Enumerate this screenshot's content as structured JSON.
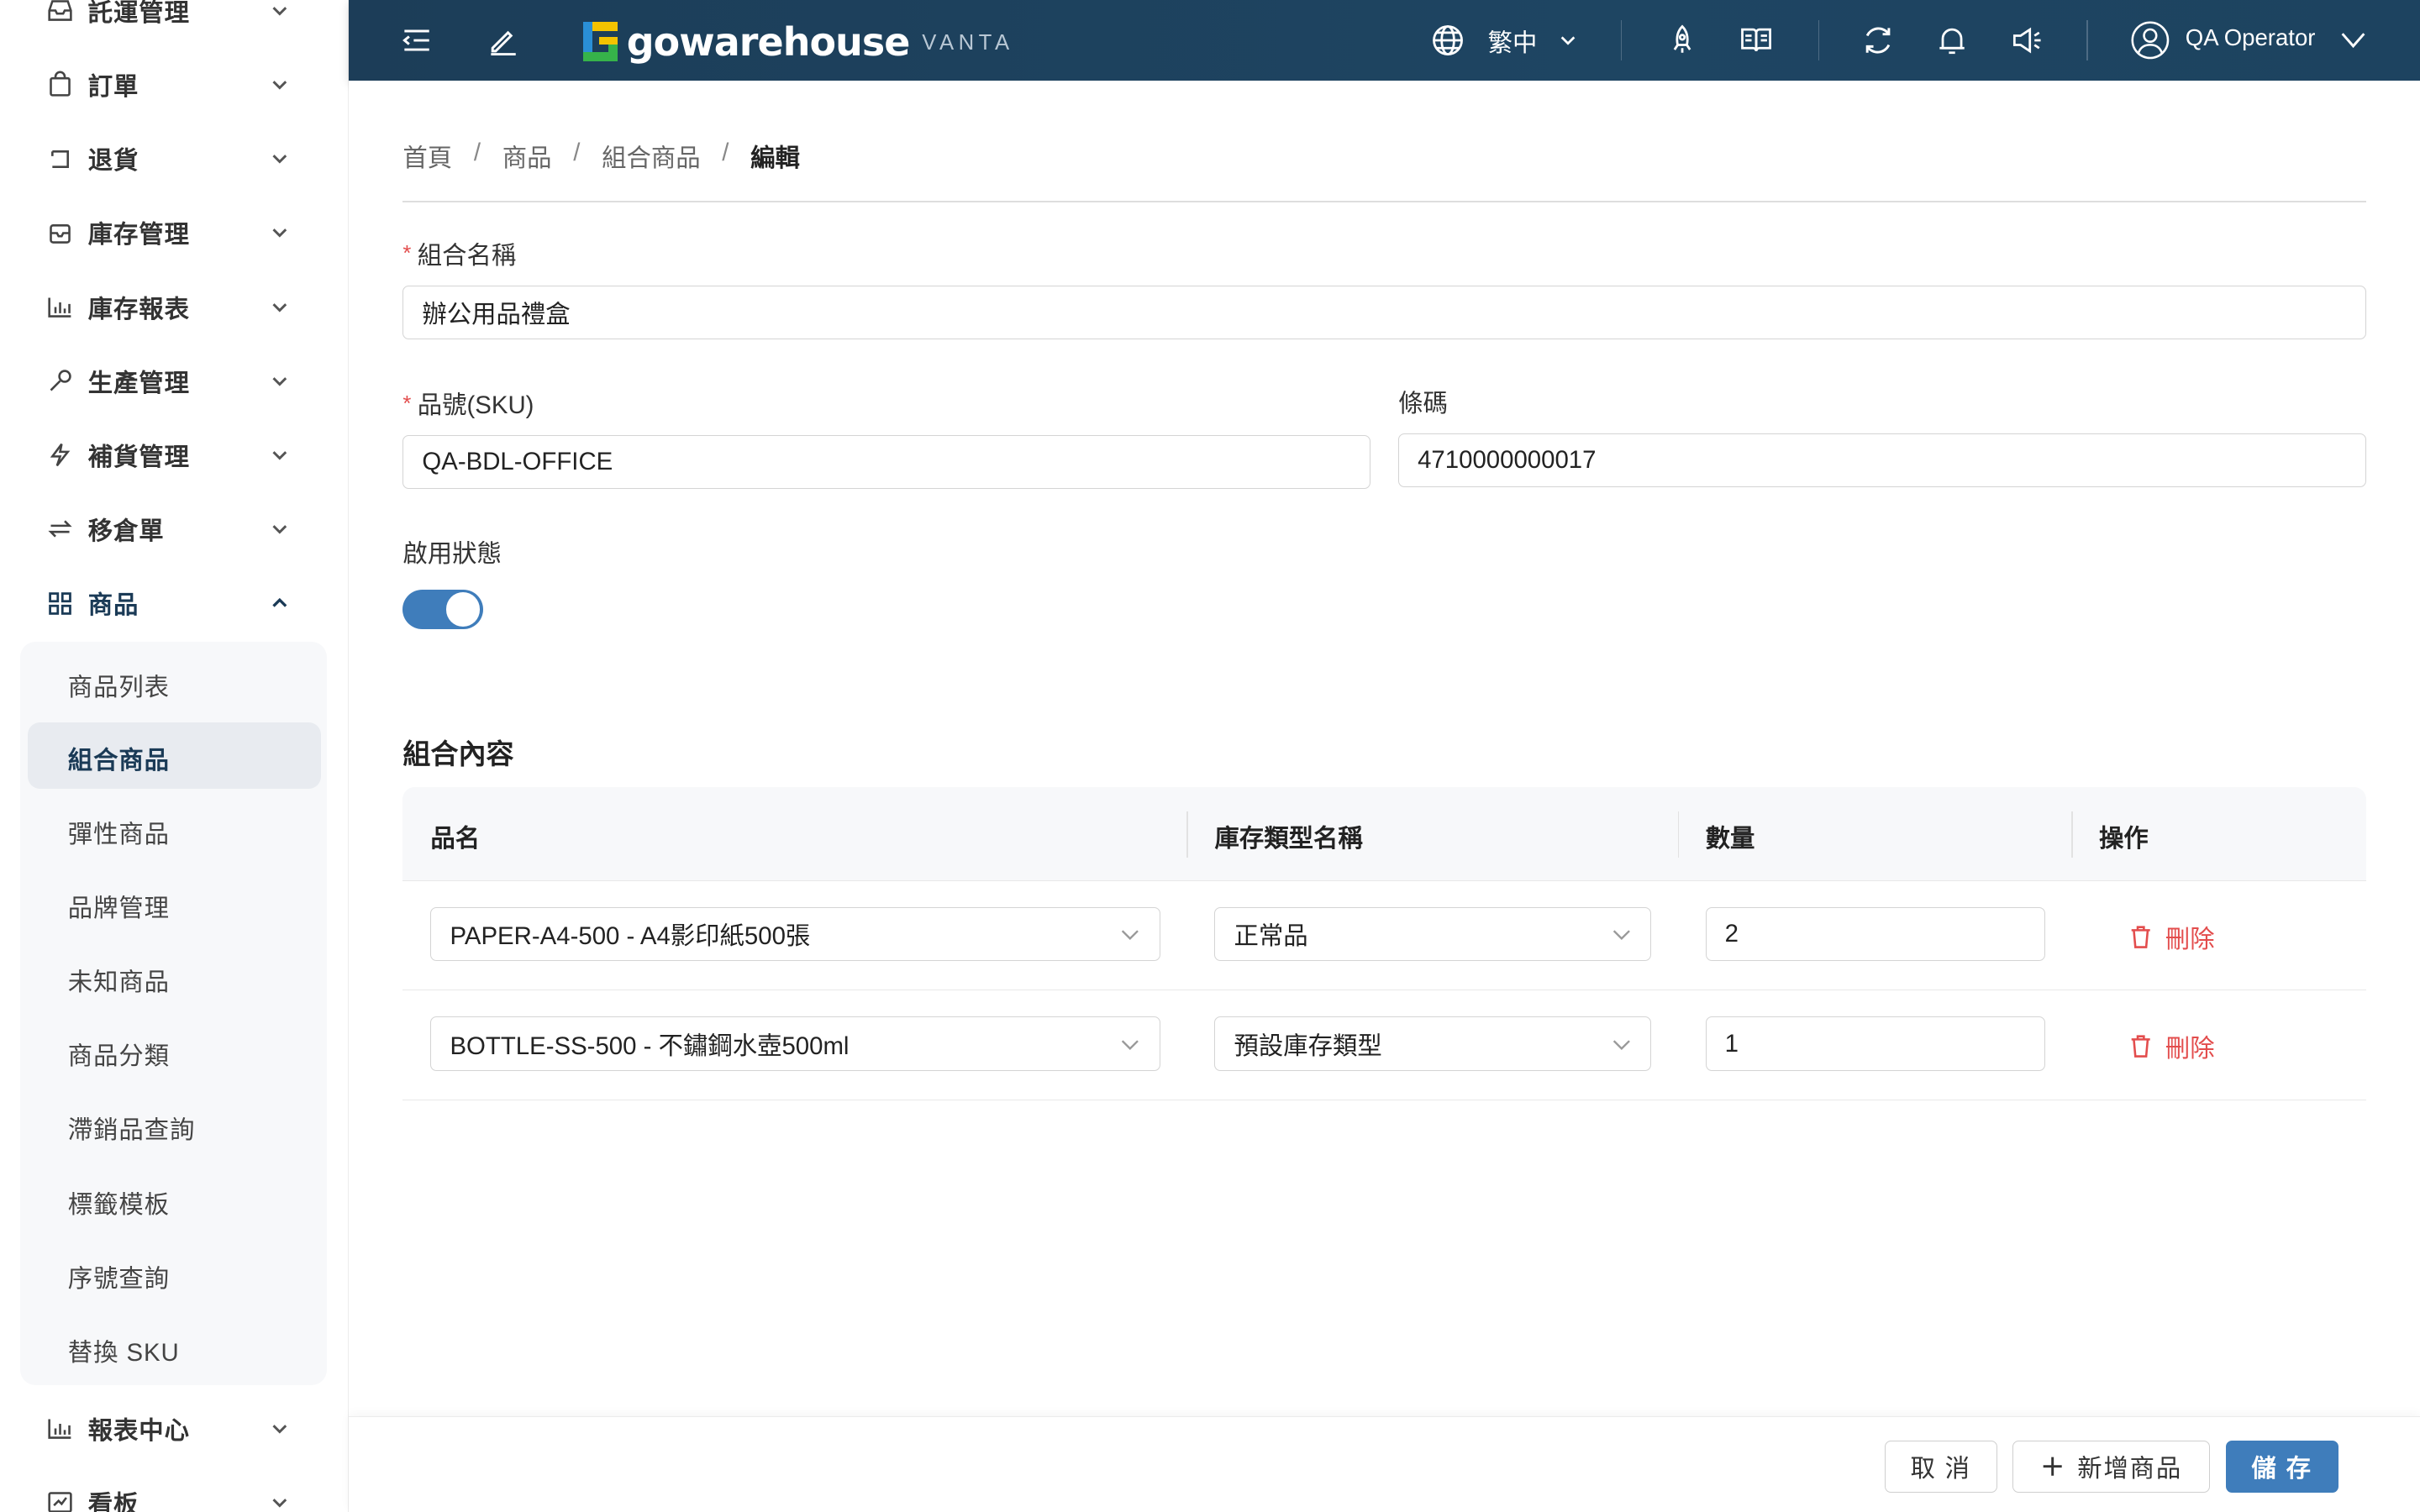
{
  "sidebar": {
    "items": [
      {
        "label": "託運管理"
      },
      {
        "label": "訂單"
      },
      {
        "label": "退貨"
      },
      {
        "label": "庫存管理"
      },
      {
        "label": "庫存報表"
      },
      {
        "label": "生產管理"
      },
      {
        "label": "補貨管理"
      },
      {
        "label": "移倉單"
      },
      {
        "label": "商品"
      },
      {
        "label": "報表中心"
      },
      {
        "label": "看板"
      }
    ],
    "submenu": [
      {
        "label": "商品列表"
      },
      {
        "label": "組合商品"
      },
      {
        "label": "彈性商品"
      },
      {
        "label": "品牌管理"
      },
      {
        "label": "未知商品"
      },
      {
        "label": "商品分類"
      },
      {
        "label": "滯銷品查詢"
      },
      {
        "label": "標籤模板"
      },
      {
        "label": "序號查詢"
      },
      {
        "label": "替換 SKU"
      }
    ],
    "active_submenu": "組合商品"
  },
  "header": {
    "logo_text": "gowarehouse",
    "logo_sub": "VANTA",
    "language": "繁中",
    "user": "QA Operator",
    "colors": {
      "bar": "#1e4562",
      "logo_blue": "#2a8fd6",
      "logo_yellow": "#f3c300",
      "logo_green": "#36b34a"
    }
  },
  "breadcrumb": [
    "首頁",
    "商品",
    "組合商品",
    "編輯"
  ],
  "form": {
    "name_label": "組合名稱",
    "name_value": "辦公用品禮盒",
    "sku_label": "品號(SKU)",
    "sku_value": "QA-BDL-OFFICE",
    "barcode_label": "條碼",
    "barcode_value": "4710000000017",
    "status_label": "啟用狀態",
    "status_enabled": true,
    "required_mark": "*"
  },
  "bundle": {
    "title": "組合內容",
    "columns": [
      "品名",
      "庫存類型名稱",
      "數量",
      "操作"
    ],
    "rows": [
      {
        "product": "PAPER-A4-500 - A4影印紙500張",
        "stock_type": "正常品",
        "qty": "2",
        "action": "刪除"
      },
      {
        "product": "BOTTLE-SS-500 - 不鏽鋼水壺500ml",
        "stock_type": "預設庫存類型",
        "qty": "1",
        "action": "刪除"
      }
    ]
  },
  "footer": {
    "cancel": "取 消",
    "add_product": "新增商品",
    "save": "儲 存"
  },
  "colors": {
    "accent": "#3f7dbb",
    "danger": "#e34d4d"
  }
}
